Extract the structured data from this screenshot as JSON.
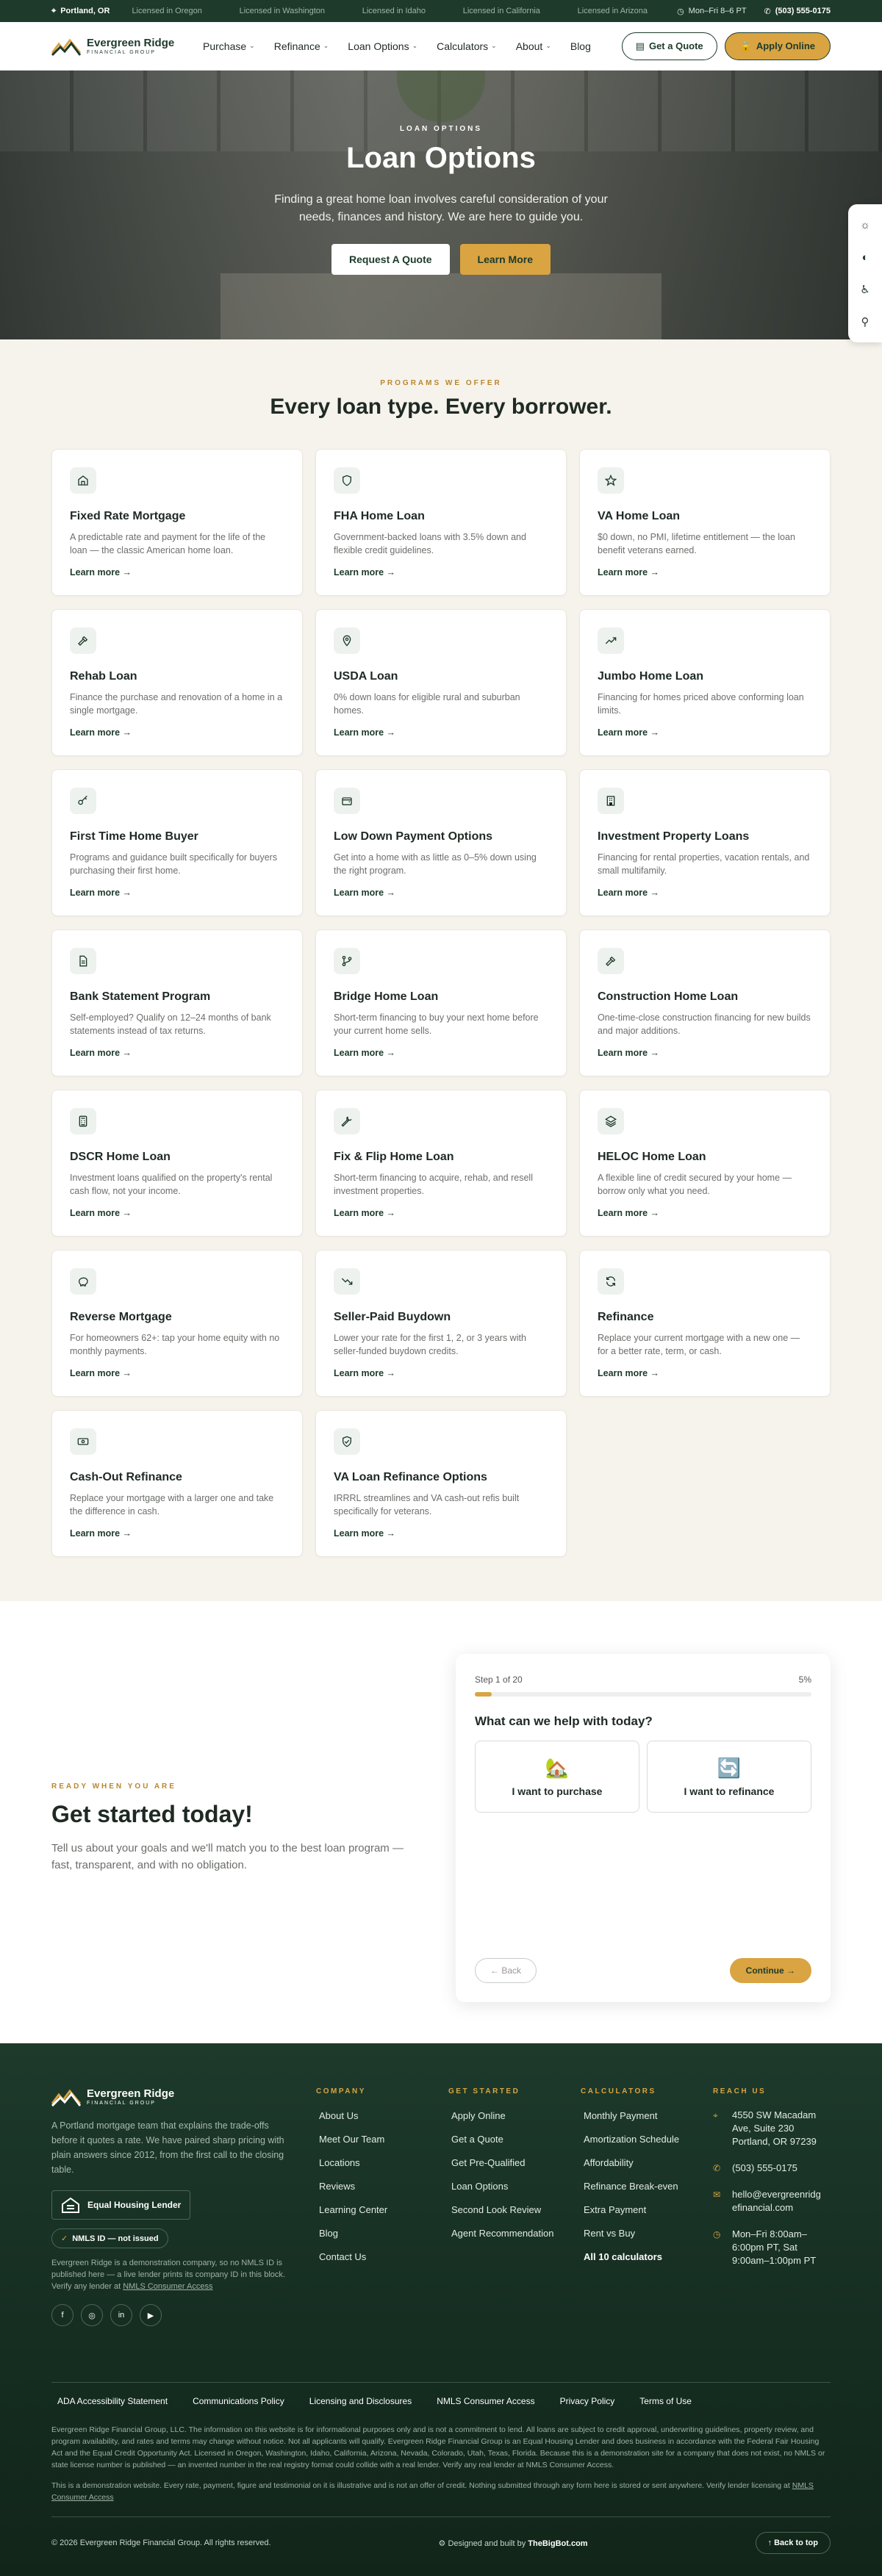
{
  "topbar": {
    "location": "Portland, OR",
    "licenses": [
      "Licensed in Oregon",
      "Licensed in Washington",
      "Licensed in Idaho",
      "Licensed in California",
      "Licensed in Arizona"
    ],
    "hours": "Mon–Fri 8–6 PT",
    "phone": "(503) 555-0175"
  },
  "brand": {
    "name": "Evergreen Ridge",
    "sub": "FINANCIAL GROUP"
  },
  "nav": {
    "items": [
      "Purchase",
      "Refinance",
      "Loan Options",
      "Calculators",
      "About",
      "Blog"
    ],
    "quote": "Get a Quote",
    "apply": "Apply Online"
  },
  "hero": {
    "eyebrow": "LOAN OPTIONS",
    "title": "Loan Options",
    "text": "Finding a great home loan involves careful consideration of your needs, finances and history. We are here to guide you.",
    "btn1": "Request A Quote",
    "btn2": "Learn More"
  },
  "programs": {
    "eyebrow": "PROGRAMS WE OFFER",
    "title": "Every loan type. Every borrower.",
    "more": "Learn more →",
    "cards": [
      {
        "title": "Fixed Rate Mortgage",
        "desc": "A predictable rate and payment for the life of the loan — the classic American home loan.",
        "icon": "home-icon"
      },
      {
        "title": "FHA Home Loan",
        "desc": "Government-backed loans with 3.5% down and flexible credit guidelines.",
        "icon": "shield-icon"
      },
      {
        "title": "VA Home Loan",
        "desc": "$0 down, no PMI, lifetime entitlement — the loan benefit veterans earned.",
        "icon": "star-icon"
      },
      {
        "title": "Rehab Loan",
        "desc": "Finance the purchase and renovation of a home in a single mortgage.",
        "icon": "hammer-icon"
      },
      {
        "title": "USDA Loan",
        "desc": "0% down loans for eligible rural and suburban homes.",
        "icon": "map-pin-icon"
      },
      {
        "title": "Jumbo Home Loan",
        "desc": "Financing for homes priced above conforming loan limits.",
        "icon": "trending-up-icon"
      },
      {
        "title": "First Time Home Buyer",
        "desc": "Programs and guidance built specifically for buyers purchasing their first home.",
        "icon": "key-icon"
      },
      {
        "title": "Low Down Payment Options",
        "desc": "Get into a home with as little as 0–5% down using the right program.",
        "icon": "wallet-icon"
      },
      {
        "title": "Investment Property Loans",
        "desc": "Financing for rental properties, vacation rentals, and small multifamily.",
        "icon": "building-icon"
      },
      {
        "title": "Bank Statement Program",
        "desc": "Self-employed? Qualify on 12–24 months of bank statements instead of tax returns.",
        "icon": "file-icon"
      },
      {
        "title": "Bridge Home Loan",
        "desc": "Short-term financing to buy your next home before your current home sells.",
        "icon": "git-branch-icon"
      },
      {
        "title": "Construction Home Loan",
        "desc": "One-time-close construction financing for new builds and major additions.",
        "icon": "hammer-icon"
      },
      {
        "title": "DSCR Home Loan",
        "desc": "Investment loans qualified on the property's rental cash flow, not your income.",
        "icon": "calculator-icon"
      },
      {
        "title": "Fix & Flip Home Loan",
        "desc": "Short-term financing to acquire, rehab, and resell investment properties.",
        "icon": "wrench-icon"
      },
      {
        "title": "HELOC Home Loan",
        "desc": "A flexible line of credit secured by your home — borrow only what you need.",
        "icon": "layers-icon"
      },
      {
        "title": "Reverse Mortgage",
        "desc": "For homeowners 62+: tap your home equity with no monthly payments.",
        "icon": "piggy-bank-icon"
      },
      {
        "title": "Seller-Paid Buydown",
        "desc": "Lower your rate for the first 1, 2, or 3 years with seller-funded buydown credits.",
        "icon": "trending-down-icon"
      },
      {
        "title": "Refinance",
        "desc": "Replace your current mortgage with a new one — for a better rate, term, or cash.",
        "icon": "refresh-icon"
      },
      {
        "title": "Cash-Out Refinance",
        "desc": "Replace your mortgage with a larger one and take the difference in cash.",
        "icon": "banknote-icon"
      },
      {
        "title": "VA Loan Refinance Options",
        "desc": "IRRRL streamlines and VA cash-out refis built specifically for veterans.",
        "icon": "shield-check-icon"
      }
    ]
  },
  "start": {
    "eyebrow": "READY WHEN YOU ARE",
    "title": "Get started today!",
    "text": "Tell us about your goals and we'll match you to the best loan program — fast, transparent, and with no obligation.",
    "quiz": {
      "step": "Step 1 of 20",
      "percent": "5%",
      "progress": 0.05,
      "question": "What can we help with today?",
      "options": [
        {
          "label": "I want to purchase",
          "emoji": "🏡"
        },
        {
          "label": "I want to refinance",
          "emoji": "🔄"
        }
      ],
      "back": "← Back",
      "continue": "Continue →"
    }
  },
  "footer": {
    "about": "A Portland mortgage team that explains the trade-offs before it quotes a rate. We have paired sharp pricing with plain answers since 2012, from the first call to the closing table.",
    "ehl": "Equal Housing Lender",
    "nmls": "NMLS ID — not issued",
    "nmls_note": "Evergreen Ridge is a demonstration company, so no NMLS ID is published here — a live lender prints its company ID in this block. Verify any lender at",
    "nmls_link": "NMLS Consumer Access",
    "socials": [
      "f",
      "◎",
      "in",
      "▶"
    ],
    "company": {
      "heading": "COMPANY",
      "links": [
        "About Us",
        "Meet Our Team",
        "Locations",
        "Reviews",
        "Learning Center",
        "Blog",
        "Contact Us"
      ]
    },
    "started": {
      "heading": "GET STARTED",
      "links": [
        "Apply Online",
        "Get a Quote",
        "Get Pre-Qualified",
        "Loan Options",
        "Second Look Review",
        "Agent Recommendation"
      ]
    },
    "calcs": {
      "heading": "CALCULATORS",
      "links": [
        "Monthly Payment",
        "Amortization Schedule",
        "Affordability",
        "Refinance Break-even",
        "Extra Payment",
        "Rent vs Buy"
      ],
      "all": "All 10 calculators"
    },
    "reach": {
      "heading": "REACH US",
      "address": "4550 SW Macadam Ave, Suite 230 Portland, OR 97239",
      "phone": "(503) 555-0175",
      "email": "hello@evergreenridgefinancial.com",
      "hours": "Mon–Fri 8:00am–6:00pm PT, Sat 9:00am–1:00pm PT"
    },
    "legal_links": [
      "ADA Accessibility Statement",
      "Communications Policy",
      "Licensing and Disclosures",
      "NMLS Consumer Access",
      "Privacy Policy",
      "Terms of Use"
    ],
    "disclaimer1": "Evergreen Ridge Financial Group, LLC. The information on this website is for informational purposes only and is not a commitment to lend. All loans are subject to credit approval, underwriting guidelines, property review, and program availability, and rates and terms may change without notice. Not all applicants will qualify. Evergreen Ridge Financial Group is an Equal Housing Lender and does business in accordance with the Federal Fair Housing Act and the Equal Credit Opportunity Act. Licensed in Oregon, Washington, Idaho, California, Arizona, Nevada, Colorado, Utah, Texas, Florida. Because this is a demonstration site for a company that does not exist, no NMLS or state license number is published — an invented number in the real registry format could collide with a real lender. Verify any real lender at NMLS Consumer Access.",
    "disclaimer2": "This is a demonstration website. Every rate, payment, figure and testimonial on it is illustrative and is not an offer of credit. Nothing submitted through any form here is stored or sent anywhere. Verify lender licensing at",
    "disclaimer2_link": "NMLS Consumer Access",
    "copyright": "© 2026 Evergreen Ridge Financial Group. All rights reserved.",
    "built_prefix": "Designed and built by",
    "built_by": "TheBigBot.com",
    "back_top": "↑  Back to top"
  }
}
